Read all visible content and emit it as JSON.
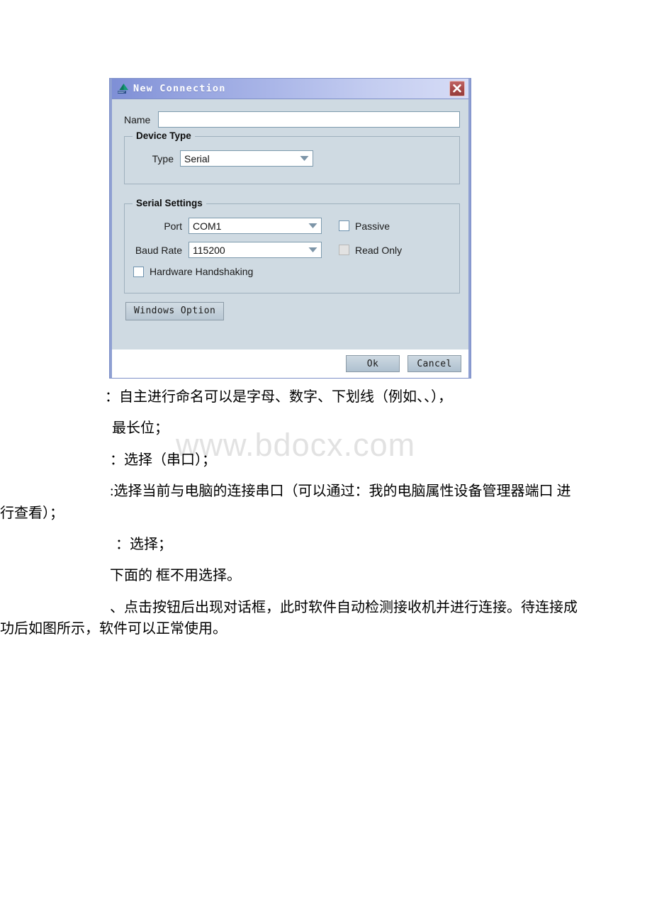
{
  "watermark": "www.bdocx.com",
  "dialog": {
    "title": "New Connection",
    "icon": "app-logo-icon",
    "close_icon": "close-icon",
    "name": {
      "label": "Name",
      "value": "",
      "placeholder": ""
    },
    "device_type": {
      "group_title": "Device Type",
      "type_label": "Type",
      "type_value": "Serial"
    },
    "serial_settings": {
      "group_title": "Serial Settings",
      "port_label": "Port",
      "port_value": "COM1",
      "baud_label": "Baud Rate",
      "baud_value": "115200",
      "passive_label": "Passive",
      "passive_checked": false,
      "read_only_label": "Read Only",
      "read_only_checked": false,
      "read_only_disabled": true,
      "handshaking_label": "Hardware Handshaking",
      "handshaking_checked": false
    },
    "windows_option_label": "Windows Option",
    "ok_label": "Ok",
    "cancel_label": "Cancel"
  },
  "colors": {
    "titlebar_start": "#7e8fd6",
    "titlebar_end": "#d6dcf6",
    "dialog_body": "#cfdae2",
    "dialog_border": "#8e9fd2",
    "close_button": "#a84a4a",
    "logo_green": "#179b77",
    "field_border": "#7d9aad",
    "watermark": "#e2e2e2"
  },
  "document": {
    "p1": "：自主进行命名可以是字母、数字、下划线（例如、、），",
    "p2": "最长位；",
    "p3": "：选择（串口）；",
    "p4": ":选择当前与电脑的连接串口（可以通过：我的电脑属性设备管理器端口 进行查看）；",
    "p5": "：选择；",
    "p6": "下面的 框不用选择。",
    "p7": "、点击按钮后出现对话框，此时软件自动检测接收机并进行连接。待连接成功后如图所示，软件可以正常使用。"
  }
}
